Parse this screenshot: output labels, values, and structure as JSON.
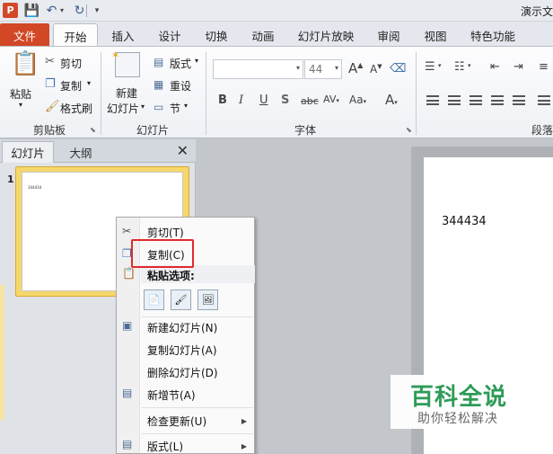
{
  "window": {
    "app_badge": "P",
    "title": "演示文"
  },
  "tabs": [
    "文件",
    "开始",
    "插入",
    "设计",
    "切换",
    "动画",
    "幻灯片放映",
    "审阅",
    "视图",
    "特色功能"
  ],
  "ribbon": {
    "clipboard": {
      "paste_label": "粘贴",
      "cut_label": "剪切",
      "copy_label": "复制",
      "format_painter_label": "格式刷",
      "group_label": "剪贴板"
    },
    "slides": {
      "new_slide_line1": "新建",
      "new_slide_line2": "幻灯片",
      "layout_label": "版式",
      "reset_label": "重设",
      "section_label": "节",
      "group_label": "幻灯片"
    },
    "font": {
      "font_name_value": "",
      "font_size_value": "44",
      "bold": "B",
      "italic": "I",
      "underline": "U",
      "shadow": "S",
      "strike": "abc",
      "spacing": "AV",
      "case": "Aa",
      "color": "A",
      "grow": "A",
      "shrink": "A",
      "group_label": "字体"
    },
    "paragraph": {
      "group_label": "段落"
    }
  },
  "panel": {
    "tab_slides": "幻灯片",
    "tab_outline": "大纲",
    "close": "✕",
    "thumb_number": "1",
    "thumb_text": "344434"
  },
  "slide": {
    "text": "344434"
  },
  "context_menu": {
    "cut": "剪切(T)",
    "copy": "复制(C)",
    "paste_options": "粘贴选项:",
    "new_slide": "新建幻灯片(N)",
    "duplicate_slide": "复制幻灯片(A)",
    "delete_slide": "删除幻灯片(D)",
    "add_section": "新增节(A)",
    "check_updates": "检查更新(U)",
    "layout": "版式(L)"
  },
  "watermark": {
    "title": "百科全说",
    "subtitle": "助你轻松解决"
  },
  "colors": {
    "file_tab": "#d24726",
    "highlight": "#e12a2a",
    "watermark": "#2e9b58",
    "thumb_frame": "#f6d76a"
  }
}
